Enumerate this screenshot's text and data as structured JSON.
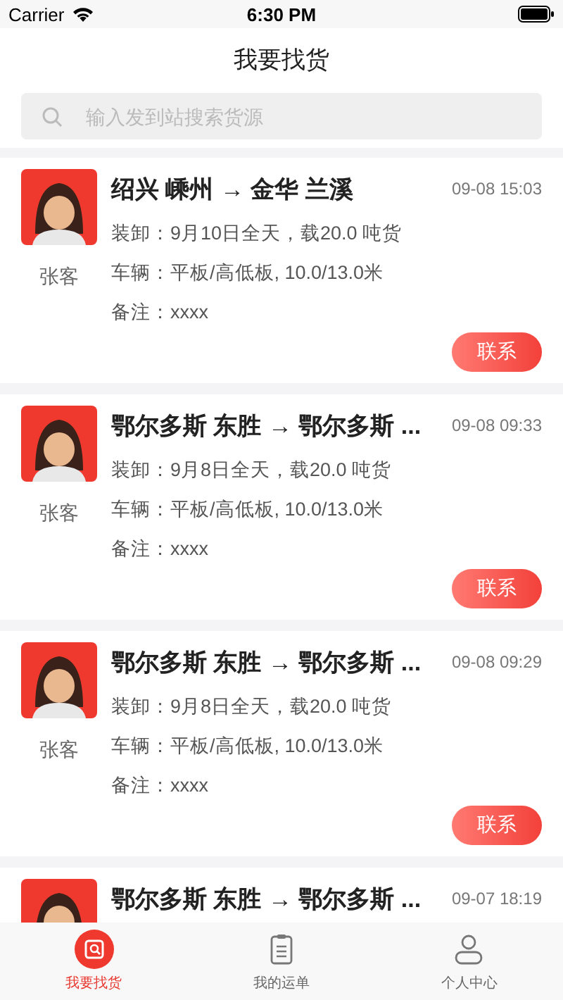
{
  "status_bar": {
    "carrier": "Carrier",
    "time": "6:30 PM"
  },
  "title": "我要找货",
  "search": {
    "placeholder": "输入发到站搜索货源"
  },
  "cards": [
    {
      "title": "绍兴 嵊州 → 金华 兰溪",
      "time": "09-08 15:03",
      "name": "张客",
      "lines": [
        "装卸：9月10日全天，载20.0 吨货",
        "车辆：平板/高低板, 10.0/13.0米",
        "备注：xxxx"
      ],
      "button": "联系"
    },
    {
      "title": "鄂尔多斯 东胜 → 鄂尔多斯 ...",
      "time": "09-08 09:33",
      "name": "张客",
      "lines": [
        "装卸：9月8日全天，载20.0 吨货",
        "车辆：平板/高低板, 10.0/13.0米",
        "备注：xxxx"
      ],
      "button": "联系"
    },
    {
      "title": "鄂尔多斯 东胜 → 鄂尔多斯 ...",
      "time": "09-08 09:29",
      "name": "张客",
      "lines": [
        "装卸：9月8日全天，载20.0 吨货",
        "车辆：平板/高低板, 10.0/13.0米",
        "备注：xxxx"
      ],
      "button": "联系"
    },
    {
      "title": "鄂尔多斯 东胜 → 鄂尔多斯 ...",
      "time": "09-07 18:19"
    }
  ],
  "tabs": [
    {
      "kind": "find",
      "label": "我要找货",
      "selected": true
    },
    {
      "kind": "orders",
      "label": "我的运单",
      "selected": false
    },
    {
      "kind": "profile",
      "label": "个人中心",
      "selected": false
    }
  ]
}
